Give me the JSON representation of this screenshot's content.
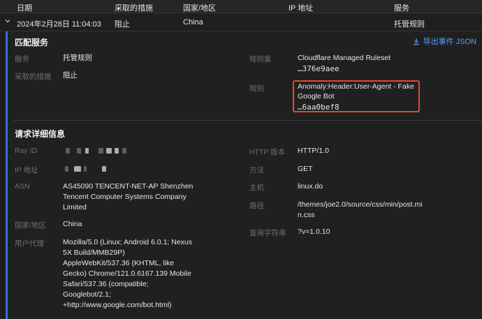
{
  "columns": {
    "date": "日期",
    "action": "采取的措施",
    "country": "国家/地区",
    "ip": "IP 地址",
    "service": "服务"
  },
  "event": {
    "date": "2024年2月28日 11:04:03",
    "action": "阻止",
    "country": "China",
    "service": "托管规则"
  },
  "match": {
    "title": "匹配服务",
    "export_label": "导出事件 JSON",
    "service_label": "服务",
    "service_value": "托管规则",
    "action_label": "采取的措施",
    "action_value": "阻止",
    "ruleset_label": "规则集",
    "ruleset_value": "Cloudflare Managed Ruleset",
    "ruleset_id": "…376e9aee",
    "rule_label": "规则",
    "rule_value_1": "Anomaly:Header:User-Agent - Fake",
    "rule_value_2": "Google Bot",
    "rule_id": "…6aa0bef8"
  },
  "request": {
    "title": "请求详细信息",
    "rayid_label": "Ray ID",
    "ip_label": "IP 地址",
    "asn_label": "ASN",
    "asn_1": "AS45090 TENCENT-NET-AP Shenzhen",
    "asn_2": "Tencent Computer Systems Company",
    "asn_3": "Limited",
    "country_label": "国家/地区",
    "country_value": "China",
    "ua_label": "用户代理",
    "ua_1": "Mozilla/5.0 (Linux; Android 6.0.1; Nexus",
    "ua_2": "5X Build/MMB29P)",
    "ua_3": "AppleWebKit/537.36 (KHTML, like",
    "ua_4": "Gecko) Chrome/121.0.6167.139 Mobile",
    "ua_5": "Safari/537.36 (compatible;",
    "ua_6": "Googlebot/2.1;",
    "ua_7": "+http://www.google.com/bot.html)",
    "http_label": "HTTP 版本",
    "http_value": "HTTP/1.0",
    "method_label": "方法",
    "method_value": "GET",
    "host_label": "主机",
    "host_value": "linux.do",
    "path_label": "路径",
    "path_1": "/themes/joe2.0/source/css/min/post.mi",
    "path_2": "n.css",
    "query_label": "查询字符串",
    "query_value": "?v=1.0.10"
  },
  "colors": {
    "accent": "#3b6fd6",
    "link": "#5a9cf8",
    "highlight_box": "#e24a2c",
    "background": "#1e1e1e"
  },
  "icons": {
    "expand": "chevron-down-icon",
    "export": "download-icon"
  }
}
